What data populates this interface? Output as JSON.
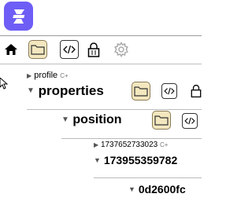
{
  "toolbar": {
    "icons": [
      "home-icon",
      "folder-icon",
      "code-icon",
      "lock-icon",
      "gear-icon"
    ]
  },
  "tree": {
    "profile": {
      "label": "profile",
      "expand_symbol": "▶",
      "add_symbol": "C+"
    },
    "properties": {
      "label": "properties",
      "expand_symbol": "▼"
    },
    "position": {
      "label": "position",
      "expand_symbol": "▼"
    },
    "key_node": {
      "label": "1737652733023",
      "expand_symbol": "▶",
      "add_symbol": "C+"
    },
    "value_node": {
      "label": "173955359782",
      "expand_symbol": "▼"
    },
    "hex_node": {
      "label": "0d2600fc",
      "expand_symbol": "▼"
    }
  }
}
